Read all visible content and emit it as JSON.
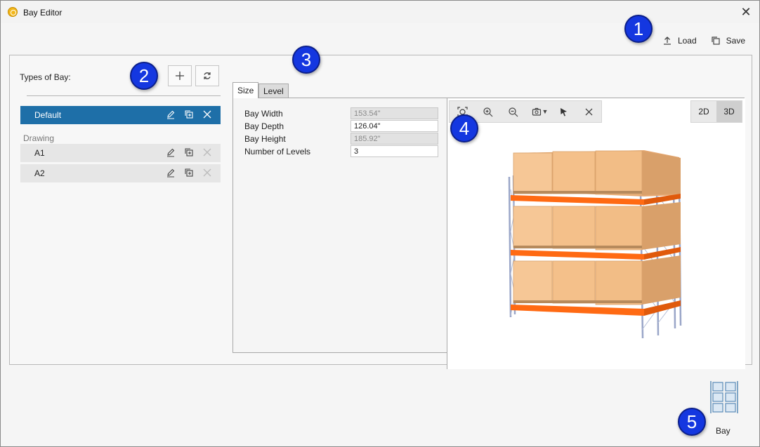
{
  "window": {
    "title": "Bay Editor"
  },
  "actions": {
    "load_label": "Load",
    "save_label": "Save"
  },
  "types_panel": {
    "label": "Types of Bay:",
    "group_label": "Drawing",
    "items": [
      {
        "label": "Default",
        "selected": true
      },
      {
        "label": "A1",
        "selected": false
      },
      {
        "label": "A2",
        "selected": false
      }
    ]
  },
  "tabs": [
    {
      "label": "Size"
    },
    {
      "label": "Level"
    }
  ],
  "size_fields": [
    {
      "label": "Bay Width",
      "value": "153.54\"",
      "disabled": true
    },
    {
      "label": "Bay Depth",
      "value": "126.04\"",
      "disabled": false
    },
    {
      "label": "Bay Height",
      "value": "185.92\"",
      "disabled": true
    },
    {
      "label": "Number of Levels",
      "value": "3",
      "disabled": false
    }
  ],
  "viewport": {
    "view_2d": "2D",
    "view_3d": "3D",
    "active_view": "3D"
  },
  "bay_button": {
    "label": "Bay"
  },
  "callouts": [
    "1",
    "2",
    "3",
    "4",
    "5"
  ],
  "colors": {
    "accent": "#1e6fa8",
    "beam": "#ff6a13",
    "box": "#f4c08a",
    "callout": "#1437e0"
  },
  "icons": [
    "app-icon",
    "close-icon",
    "upload-icon",
    "copy-icon",
    "plus-icon",
    "refresh-icon",
    "pencil-icon",
    "duplicate-icon",
    "delete-icon",
    "zoom-fit-icon",
    "zoom-in-icon",
    "zoom-out-icon",
    "camera-icon",
    "cursor-icon",
    "bay-icon"
  ]
}
